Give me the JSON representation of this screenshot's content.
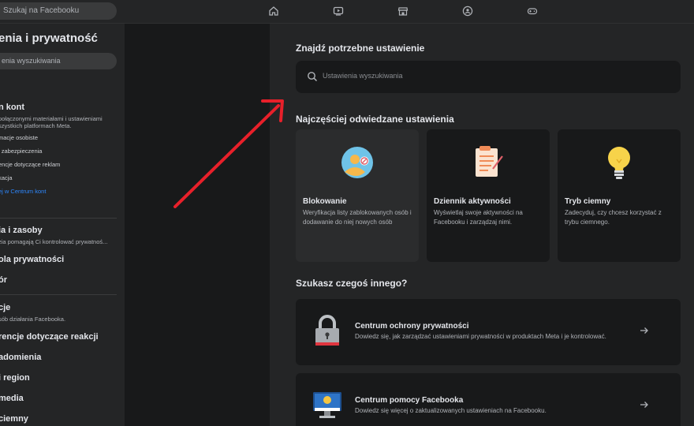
{
  "topbar": {
    "search_placeholder": "Szukaj na Facebooku",
    "nav_icons": [
      "home-icon",
      "video-icon",
      "marketplace-icon",
      "groups-icon",
      "gaming-icon"
    ]
  },
  "sidebar": {
    "title": "enia i prywatność",
    "search_placeholder": "enia wyszukiwania",
    "accounts_center": {
      "label": "n kont",
      "desc1": "połączonymi materiałami i ustawieniami",
      "desc2": "szystkich platformach Meta.",
      "items": [
        "macje osobiste",
        "i zabezpieczenia",
        "encje dotyczące reklam",
        "kacja"
      ],
      "link": "ej w Centrum kont"
    },
    "tools": {
      "label": "ia i zasoby",
      "desc": "zia pomagają Ci kontrolować prywatnoś..."
    },
    "items_a": [
      "ola prywatności",
      "ór"
    ],
    "prefs": {
      "label": "cje",
      "desc": "sób działania Facebooka."
    },
    "items_b": [
      "rencje dotyczące reakcji",
      "adomienia",
      "i region",
      "media",
      "ciemny"
    ]
  },
  "main": {
    "find_title": "Znajdź potrzebne ustawienie",
    "search_placeholder": "Ustawienia wyszukiwania",
    "frequent_title": "Najczęściej odwiedzane ustawienia",
    "cards": [
      {
        "title": "Blokowanie",
        "desc": "Weryfikacja listy zablokowanych osób i dodawanie do niej nowych osób",
        "icon": "blocked-user-icon"
      },
      {
        "title": "Dziennik aktywności",
        "desc": "Wyświetlaj swoje aktywności na Facebooku i zarządzaj nimi.",
        "icon": "activity-log-icon"
      },
      {
        "title": "Tryb ciemny",
        "desc": "Zadecyduj, czy chcesz korzystać z trybu ciemnego.",
        "icon": "lightbulb-icon"
      }
    ],
    "other_title": "Szukasz czegoś innego?",
    "rows": [
      {
        "title": "Centrum ochrony prywatności",
        "desc": "Dowiedz się, jak zarządzać ustawieniami prywatności w produktach Meta i je kontrolować.",
        "icon": "padlock-icon"
      },
      {
        "title": "Centrum pomocy Facebooka",
        "desc": "Dowiedz się więcej o zaktualizowanych ustawieniach na Facebooku.",
        "icon": "monitor-icon"
      }
    ]
  },
  "colors": {
    "accent_link": "#2d88ff",
    "annotation_arrow": "#e8202a",
    "panel": "#242526",
    "card": "#18191a"
  }
}
